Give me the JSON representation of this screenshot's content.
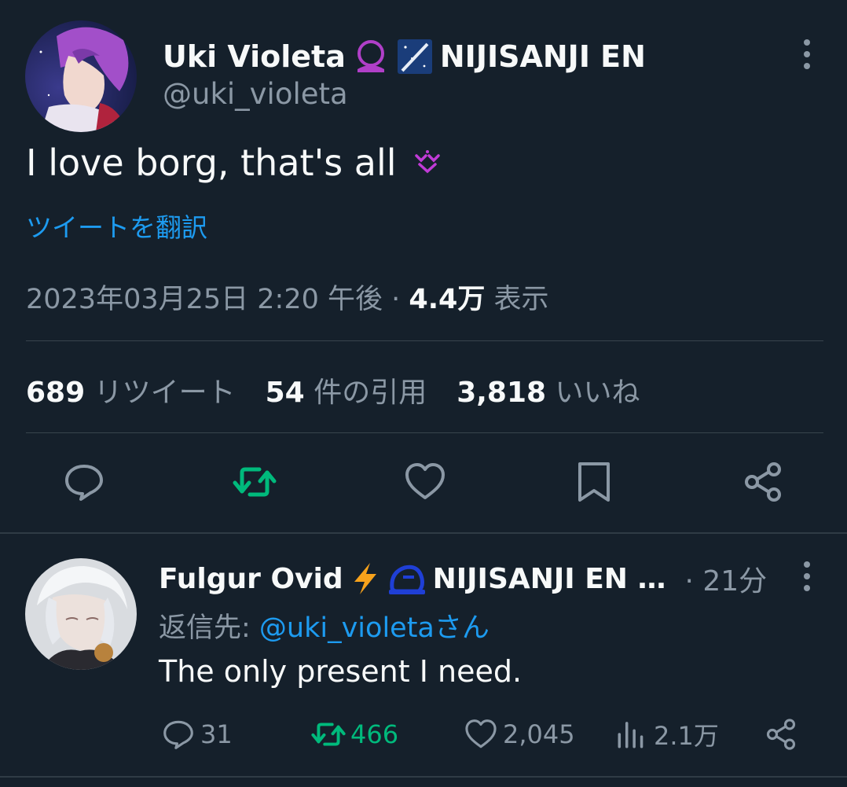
{
  "main_tweet": {
    "author_name": "Uki Violeta",
    "author_suffix": "NIJISANJI EN",
    "handle": "@uki_violeta",
    "text": "I love borg, that's all",
    "translate_label": "ツイートを翻訳",
    "timestamp": "2023年03月25日 2:20 午後",
    "separator": " · ",
    "views_count": "4.4万",
    "views_label": "表示",
    "retweets_count": "689",
    "retweets_label": "リツイート",
    "quotes_count": "54",
    "quotes_label": "件の引用",
    "likes_count": "3,818",
    "likes_label": "いいね",
    "actions": [
      "reply-icon",
      "retweet-icon",
      "like-icon",
      "bookmark-icon",
      "share-icon"
    ]
  },
  "reply": {
    "author_name": "Fulgur Ovid",
    "author_suffix": "NIJISANJI EN …",
    "time": "· 21分",
    "reply_to_prefix": "返信先: ",
    "reply_to_handle": "@uki_violetaさん",
    "text": "The only present I need.",
    "reply_count": "31",
    "retweet_count": "466",
    "like_count": "2,045",
    "views_count": "2.1万"
  },
  "colors": {
    "background": "#15202b",
    "text": "#f7f9f9",
    "muted": "#8b98a5",
    "link": "#1d9bf0",
    "retweet_green": "#00ba7c",
    "emoji_magenta": "#c03bd6"
  }
}
